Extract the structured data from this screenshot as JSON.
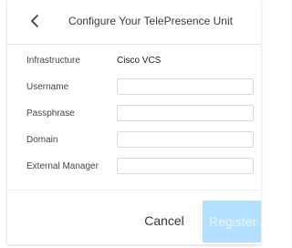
{
  "dialog": {
    "title": "Configure Your TelePresence Unit",
    "back_icon": "chevron-left-icon"
  },
  "form": {
    "infrastructure": {
      "label": "Infrastructure",
      "value": "Cisco VCS"
    },
    "username": {
      "label": "Username",
      "value": "",
      "placeholder": ""
    },
    "passphrase": {
      "label": "Passphrase",
      "value": "",
      "placeholder": ""
    },
    "domain": {
      "label": "Domain",
      "value": "",
      "placeholder": ""
    },
    "external_manager": {
      "label": "External Manager",
      "value": "",
      "placeholder": ""
    }
  },
  "actions": {
    "cancel_label": "Cancel",
    "register_label": "Register",
    "register_color": "#b3e0ff"
  }
}
